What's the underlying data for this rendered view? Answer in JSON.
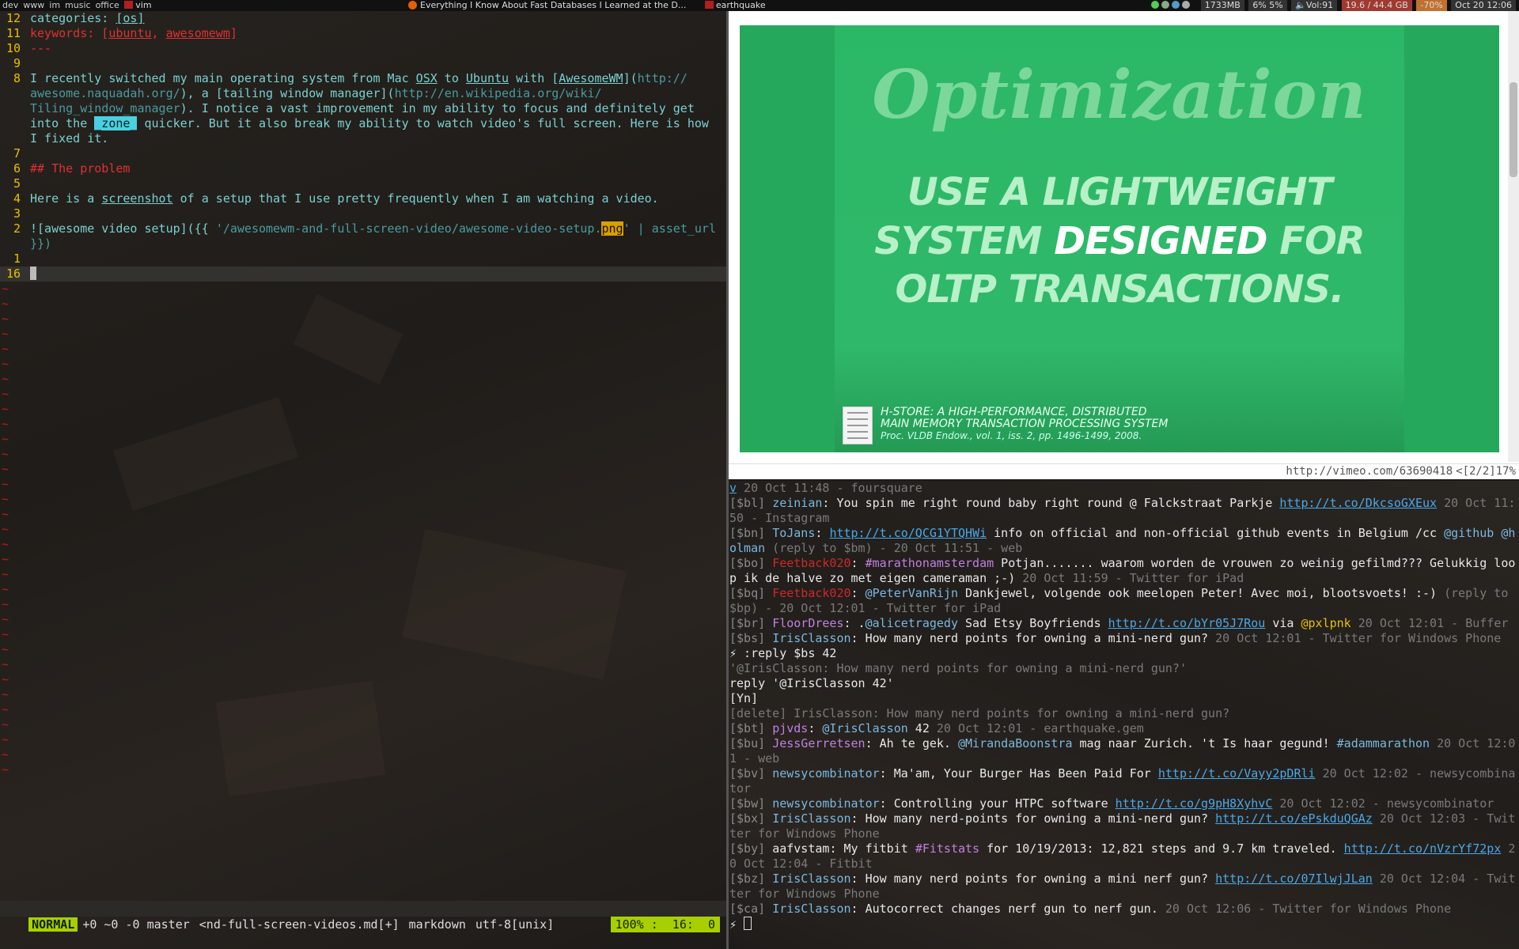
{
  "topbar": {
    "tags": [
      "dev",
      "www",
      "im",
      "music",
      "office"
    ],
    "active_app": "vim",
    "tasks": [
      "Everything I Know About Fast Databases I Learned at the D...",
      "earthquake"
    ],
    "status": {
      "memory": "1733MB",
      "cpu": "6% 5%",
      "volume": "Vol:91",
      "disk": "19.6 / 44.4 GB",
      "battery": "-70%",
      "clock": "Oct 20 12:06"
    }
  },
  "vim": {
    "lines": [
      {
        "num": "12",
        "segments": [
          {
            "t": "categories: ",
            "c": "txt"
          },
          {
            "t": "[os]",
            "c": "txt ul"
          }
        ]
      },
      {
        "num": "11",
        "segments": [
          {
            "t": "keywords: [",
            "c": "red"
          },
          {
            "t": "ubuntu",
            "c": "red ul"
          },
          {
            "t": ", ",
            "c": "red"
          },
          {
            "t": "awesomewm",
            "c": "red ul"
          },
          {
            "t": "]",
            "c": "red"
          }
        ]
      },
      {
        "num": "10",
        "segments": [
          {
            "t": "---",
            "c": "red"
          }
        ]
      },
      {
        "num": "9",
        "segments": []
      },
      {
        "num": "8",
        "segments": [
          {
            "t": "I recently switched my main operating system from Mac ",
            "c": "txt"
          },
          {
            "t": "OSX",
            "c": "txt ul"
          },
          {
            "t": " to ",
            "c": "txt"
          },
          {
            "t": "Ubuntu",
            "c": "txt ul"
          },
          {
            "t": " with [",
            "c": "txt"
          },
          {
            "t": "AwesomeWM",
            "c": "txt ul"
          },
          {
            "t": "](",
            "c": "txt"
          },
          {
            "t": "http://",
            "c": "dim"
          }
        ]
      },
      {
        "num": "",
        "segments": [
          {
            "t": "awesome.naquadah.org/",
            "c": "dim"
          },
          {
            "t": "), a [tailing window manager](",
            "c": "txt"
          },
          {
            "t": "http://en.wikipedia.org/wiki/",
            "c": "dim"
          }
        ]
      },
      {
        "num": "",
        "segments": [
          {
            "t": "Tiling_window_manager",
            "c": "dim"
          },
          {
            "t": "). I notice a vast improvement in my ability to focus and definitely get",
            "c": "txt"
          }
        ]
      },
      {
        "num": "",
        "segments": [
          {
            "t": "into the ",
            "c": "txt"
          },
          {
            "t": "_zone_",
            "c": "hl"
          },
          {
            "t": " quicker. But it also break my ability to watch video's full screen. Here is how",
            "c": "txt"
          }
        ]
      },
      {
        "num": "",
        "segments": [
          {
            "t": "I fixed it.",
            "c": "txt"
          }
        ]
      },
      {
        "num": "7",
        "segments": []
      },
      {
        "num": "6",
        "segments": [
          {
            "t": "## The problem",
            "c": "red"
          }
        ]
      },
      {
        "num": "5",
        "segments": []
      },
      {
        "num": "4",
        "segments": [
          {
            "t": "Here is a ",
            "c": "txt"
          },
          {
            "t": "screenshot",
            "c": "txt ul"
          },
          {
            "t": " of a setup that I use pretty frequently when I am watching a video.",
            "c": "txt"
          }
        ]
      },
      {
        "num": "3",
        "segments": []
      },
      {
        "num": "2",
        "segments": [
          {
            "t": "![awesome video setup]({{ ",
            "c": "txt"
          },
          {
            "t": "'/awesomewm-and-full-screen-video/awesome-video-setup.",
            "c": "dim"
          },
          {
            "t": "png",
            "c": "ylw"
          },
          {
            "t": "' | asset_url",
            "c": "dim"
          }
        ]
      },
      {
        "num": "",
        "segments": [
          {
            "t": "}})",
            "c": "dim"
          }
        ]
      },
      {
        "num": "1",
        "segments": []
      }
    ],
    "current_line_num": "16",
    "tilde_count": 33,
    "tilde_char": "~",
    "statusline": {
      "mode": "NORMAL",
      "git": "+0 ~0 -0 master",
      "file": "<nd-full-screen-videos.md[+]",
      "filetype": "markdown",
      "encoding": "utf-8[unix]",
      "position": "100% :  16:  0"
    }
  },
  "browser": {
    "video": {
      "heading": "Optimization",
      "line1": "USE A LIGHTWEIGHT",
      "line2_pre": "SYSTEM ",
      "line2_em": "DESIGNED",
      "line2_post": " FOR",
      "line3": "OLTP TRANSACTIONS.",
      "cite1": "H-STORE: A HIGH-PERFORMANCE, DISTRIBUTED",
      "cite2": "MAIN MEMORY TRANSACTION PROCESSING SYSTEM",
      "cite3": "Proc. VLDB Endow., vol. 1, iss. 2, pp. 1496-1499, 2008."
    },
    "url": "http://vimeo.com/63690418",
    "page_info": "<[2/2]17%"
  },
  "terminal": {
    "lines": [
      [
        {
          "t": "v",
          "c": "link"
        },
        {
          "t": " 20 Oct 11:48 - foursquare",
          "c": "meta"
        }
      ],
      [
        {
          "t": "[$bl] ",
          "c": "tid"
        },
        {
          "t": "zeinian",
          "c": "user"
        },
        {
          "t": ": You spin me right round baby right round @ Falckstraat Parkje ",
          "c": ""
        },
        {
          "t": "http://t.co/DkcsoGXEux",
          "c": "link"
        },
        {
          "t": " 20 Oct 11:50 - Instagram",
          "c": "meta"
        }
      ],
      [
        {
          "t": "[$bn] ",
          "c": "tid"
        },
        {
          "t": "ToJans",
          "c": "user"
        },
        {
          "t": ": ",
          "c": ""
        },
        {
          "t": "http://t.co/QCG1YTQHWi",
          "c": "link"
        },
        {
          "t": " info on official and non-official github events in Belgium /cc ",
          "c": ""
        },
        {
          "t": "@github @holman",
          "c": "user"
        },
        {
          "t": " (reply to $bm) - 20 Oct 11:51 - web",
          "c": "meta"
        }
      ],
      [
        {
          "t": "[$bo] ",
          "c": "tid"
        },
        {
          "t": "Feetback020",
          "c": "user-red"
        },
        {
          "t": ": ",
          "c": ""
        },
        {
          "t": "#marathonamsterdam",
          "c": "tag2"
        },
        {
          "t": " Potjan....... waarom worden de vrouwen zo weinig gefilmd??? Gelukkig loop ik de halve zo met eigen cameraman ;-) ",
          "c": ""
        },
        {
          "t": "20 Oct 11:59 - Twitter for iPad",
          "c": "meta"
        }
      ],
      [
        {
          "t": "[$bq] ",
          "c": "tid"
        },
        {
          "t": "Feetback020",
          "c": "user-red"
        },
        {
          "t": ": ",
          "c": ""
        },
        {
          "t": "@PeterVanRijn",
          "c": "user"
        },
        {
          "t": " Dankjewel, volgende ook meelopen Peter! Avec moi, blootsvoets! :-) ",
          "c": ""
        },
        {
          "t": "(reply to $bp) - 20 Oct 12:01 - Twitter for iPad",
          "c": "meta"
        }
      ],
      [
        {
          "t": "[$br] ",
          "c": "tid"
        },
        {
          "t": "FloorDrees",
          "c": "tag2"
        },
        {
          "t": ": .",
          "c": ""
        },
        {
          "t": "@alicetragedy",
          "c": "user"
        },
        {
          "t": " Sad Etsy Boyfriends ",
          "c": ""
        },
        {
          "t": "http://t.co/bYr05J7Rou",
          "c": "link"
        },
        {
          "t": " via ",
          "c": ""
        },
        {
          "t": "@pxlpnk",
          "c": "at"
        },
        {
          "t": " 20 Oct 12:01 - Buffer",
          "c": "meta"
        }
      ],
      [
        {
          "t": "[$bs] ",
          "c": "tid"
        },
        {
          "t": "IrisClasson",
          "c": "user"
        },
        {
          "t": ": How many nerd points for owning a mini-nerd gun? ",
          "c": ""
        },
        {
          "t": "20 Oct 12:01 - Twitter for Windows Phone",
          "c": "meta"
        }
      ],
      [
        {
          "t": "⚡ :reply $bs 42",
          "c": ""
        }
      ],
      [
        {
          "t": "'@IrisClasson: How many nerd points for owning a mini-nerd gun?'",
          "c": "meta"
        }
      ],
      [
        {
          "t": "reply '@IrisClasson 42'",
          "c": ""
        }
      ],
      [
        {
          "t": "[Yn]",
          "c": ""
        }
      ],
      [
        {
          "t": "[delete] IrisClasson: How many nerd points for owning a mini-nerd gun?",
          "c": "meta"
        }
      ],
      [
        {
          "t": "[$bt] ",
          "c": "tid"
        },
        {
          "t": "pjvds",
          "c": "tag2"
        },
        {
          "t": ": ",
          "c": ""
        },
        {
          "t": "@IrisClasson",
          "c": "user"
        },
        {
          "t": " 42 ",
          "c": ""
        },
        {
          "t": "20 Oct 12:01 - earthquake.gem",
          "c": "meta"
        }
      ],
      [
        {
          "t": "[$bu] ",
          "c": "tid"
        },
        {
          "t": "JessGerretsen",
          "c": "tag2"
        },
        {
          "t": ": Ah te gek. ",
          "c": ""
        },
        {
          "t": "@MirandaBoonstra",
          "c": "user"
        },
        {
          "t": " mag naar Zurich. 't Is haar gegund! ",
          "c": ""
        },
        {
          "t": "#adammarathon",
          "c": "user"
        },
        {
          "t": " 20 Oct 12:01 - web",
          "c": "meta"
        }
      ],
      [
        {
          "t": "[$bv] ",
          "c": "tid"
        },
        {
          "t": "newsycombinator",
          "c": "user"
        },
        {
          "t": ": Ma'am, Your Burger Has Been Paid For ",
          "c": ""
        },
        {
          "t": "http://t.co/Vayy2pDRli",
          "c": "link"
        },
        {
          "t": " 20 Oct 12:02 - newsycombinator",
          "c": "meta"
        }
      ],
      [
        {
          "t": "[$bw] ",
          "c": "tid"
        },
        {
          "t": "newsycombinator",
          "c": "user"
        },
        {
          "t": ": Controlling your HTPC software ",
          "c": ""
        },
        {
          "t": "http://t.co/g9pH8XyhvC",
          "c": "link"
        },
        {
          "t": " 20 Oct 12:02 - newsycombinator",
          "c": "meta"
        }
      ],
      [
        {
          "t": "[$bx] ",
          "c": "tid"
        },
        {
          "t": "IrisClasson",
          "c": "user"
        },
        {
          "t": ": How many nerd-points for owning a mini-nerd gun? ",
          "c": ""
        },
        {
          "t": "http://t.co/ePskduQGAz",
          "c": "link"
        },
        {
          "t": " 20 Oct 12:03 - Twitter for Windows Phone",
          "c": "meta"
        }
      ],
      [
        {
          "t": "[$by] ",
          "c": "tid"
        },
        {
          "t": "aafvstam",
          "c": ""
        },
        {
          "t": ": My fitbit ",
          "c": ""
        },
        {
          "t": "#Fitstats",
          "c": "tag2"
        },
        {
          "t": " for 10/19/2013: 12,821 steps and 9.7 km traveled. ",
          "c": ""
        },
        {
          "t": "http://t.co/nVzrYf72px",
          "c": "link"
        },
        {
          "t": " 20 Oct 12:04 - Fitbit",
          "c": "meta"
        }
      ],
      [
        {
          "t": "[$bz] ",
          "c": "tid"
        },
        {
          "t": "IrisClasson",
          "c": "user"
        },
        {
          "t": ": How many nerd points for owning a mini nerf gun? ",
          "c": ""
        },
        {
          "t": "http://t.co/07IlwjJLan",
          "c": "link"
        },
        {
          "t": " 20 Oct 12:04 - Twitter for Windows Phone",
          "c": "meta"
        }
      ],
      [
        {
          "t": "[$ca] ",
          "c": "tid"
        },
        {
          "t": "IrisClasson",
          "c": "user"
        },
        {
          "t": ": Autocorrect changes nerf gun to nerf gun. ",
          "c": ""
        },
        {
          "t": "20 Oct 12:06 - Twitter for Windows Phone",
          "c": "meta"
        }
      ]
    ],
    "prompt": "⚡ "
  }
}
